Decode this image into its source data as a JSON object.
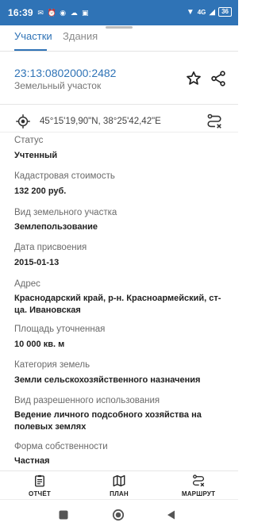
{
  "status_bar": {
    "time": "16:39",
    "battery": "36",
    "signal": "4G"
  },
  "tabs": [
    {
      "label": "Участки",
      "active": true
    },
    {
      "label": "Здания",
      "active": false
    }
  ],
  "parcel": {
    "cadastral_number": "23:13:0802000:2482",
    "subtitle": "Земельный участок"
  },
  "coordinates": "45°15'19,90\"N, 38°25'42,42\"E",
  "properties": [
    {
      "label": "Статус",
      "value": "Учтенный"
    },
    {
      "label": "Кадастровая стоимость",
      "value": "132 200 руб."
    },
    {
      "label": "Вид земельного участка",
      "value": "Землепользование"
    },
    {
      "label": "Дата присвоения",
      "value": "2015-01-13"
    },
    {
      "label": "Адрес",
      "value": "Краснодарский край, р-н. Красноармейский, ст-ца. Ивановская"
    },
    {
      "label": "Площадь уточненная",
      "value": "10 000 кв. м"
    },
    {
      "label": "Категория земель",
      "value": "Земли сельскохозяйственного назначения"
    },
    {
      "label": "Вид разрешенного использования",
      "value": "Ведение личного подсобного хозяйства на полевых землях"
    },
    {
      "label": "Форма собственности",
      "value": "Частная"
    }
  ],
  "bottom_nav": {
    "report": "ОТЧЁТ",
    "plan": "ПЛАН",
    "route": "МАРШРУТ"
  },
  "icons": {
    "star": "star-outline-icon",
    "share": "share-icon",
    "gps": "gps-target-icon",
    "route": "route-icon",
    "report": "clipboard-icon",
    "plan": "map-icon"
  },
  "colors": {
    "accent": "#2f73b6",
    "status_bar": "#2f73b6"
  }
}
